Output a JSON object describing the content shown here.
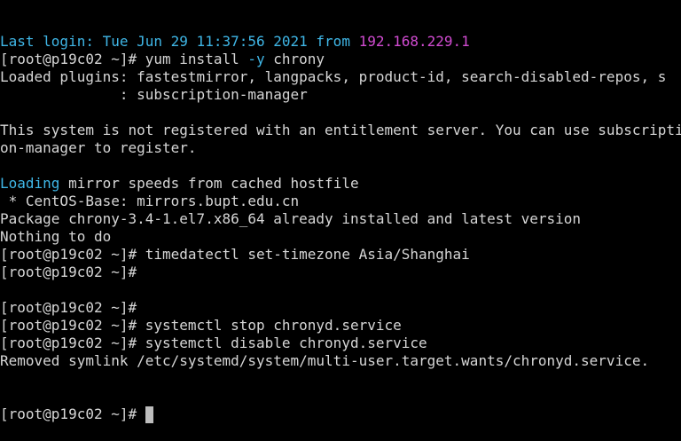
{
  "terminal": {
    "colors": {
      "background": "#000000",
      "text": "#d6d6d6",
      "loading_highlight": "#3fb6e6",
      "option_highlight": "#3fb6e6",
      "ip_highlight": "#d14bd1"
    },
    "lines": [
      {
        "segments": [
          {
            "text": "Last login: Tue Jun 29 11:37:56 2021 from ",
            "cls": "seg-cyan"
          },
          {
            "text": "192.168.229.1",
            "cls": "seg-magenta"
          }
        ]
      },
      {
        "segments": [
          {
            "text": "[root@p19c02 ~]# yum install "
          },
          {
            "text": "-y",
            "cls": "seg-cyan"
          },
          {
            "text": " chrony"
          }
        ]
      },
      {
        "segments": [
          {
            "text": "Loaded plugins: fastestmirror, langpacks, product-id, search-disabled-repos, s"
          }
        ]
      },
      {
        "segments": [
          {
            "text": "              : subscription-manager"
          }
        ]
      },
      {
        "segments": [
          {
            "text": ""
          }
        ]
      },
      {
        "segments": [
          {
            "text": "This system is not registered with an entitlement server. You can use subscripti"
          }
        ]
      },
      {
        "segments": [
          {
            "text": "on-manager to register."
          }
        ]
      },
      {
        "segments": [
          {
            "text": ""
          }
        ]
      },
      {
        "segments": [
          {
            "text": "Loading",
            "cls": "seg-cyan"
          },
          {
            "text": " mirror speeds from cached hostfile"
          }
        ]
      },
      {
        "segments": [
          {
            "text": " * CentOS-Base: mirrors.bupt.edu.cn"
          }
        ]
      },
      {
        "segments": [
          {
            "text": "Package chrony-3.4-1.el7.x86_64 already installed and latest version"
          }
        ]
      },
      {
        "segments": [
          {
            "text": "Nothing to do"
          }
        ]
      },
      {
        "segments": [
          {
            "text": "[root@p19c02 ~]# timedatectl set-timezone Asia/Shanghai"
          }
        ]
      },
      {
        "segments": [
          {
            "text": "[root@p19c02 ~]#"
          }
        ]
      },
      {
        "segments": [
          {
            "text": ""
          }
        ]
      },
      {
        "segments": [
          {
            "text": "[root@p19c02 ~]#"
          }
        ]
      },
      {
        "segments": [
          {
            "text": "[root@p19c02 ~]# systemctl stop chronyd.service"
          }
        ]
      },
      {
        "segments": [
          {
            "text": "[root@p19c02 ~]# systemctl disable chronyd.service"
          }
        ]
      },
      {
        "segments": [
          {
            "text": "Removed symlink /etc/systemd/system/multi-user.target.wants/chronyd.service."
          }
        ]
      }
    ],
    "prompt": "[root@p19c02 ~]# ",
    "cursor": "block-cursor"
  }
}
